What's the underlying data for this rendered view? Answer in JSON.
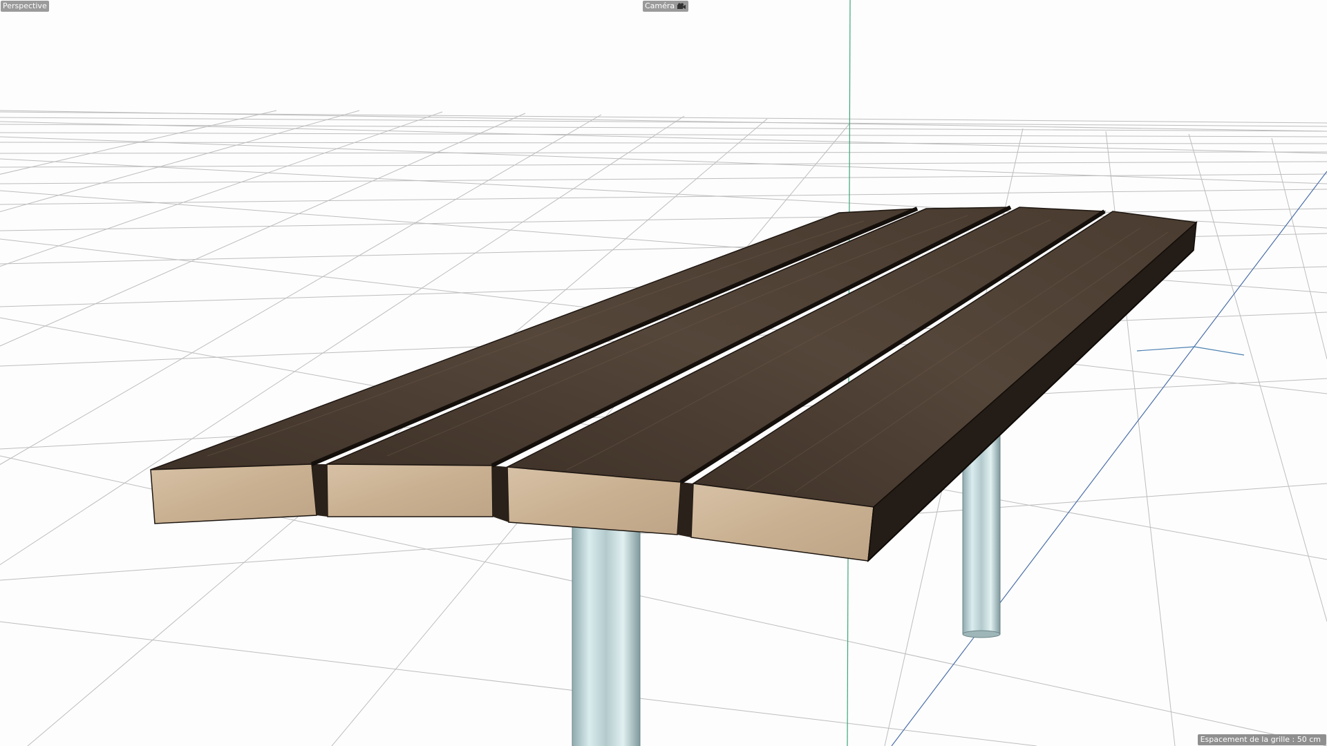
{
  "viewport": {
    "view_label": "Perspective",
    "camera_label": "Caméra",
    "camera_icon": "camera-icon",
    "grid_spacing_text": "Espacement de la grille : 50 cm"
  },
  "scene": {
    "object": "wooden bench",
    "plank_count": 4,
    "leg_count": 2,
    "colors": {
      "background": "#fdfdfd",
      "grid_line": "#b9b9b9",
      "axis_green": "#3aa57a",
      "axis_blue": "#4a6ea8",
      "plank_top": "#4b3d30",
      "plank_end": "#cdb59a",
      "plank_side": "#2a211a",
      "leg": "#b7ced0"
    }
  }
}
